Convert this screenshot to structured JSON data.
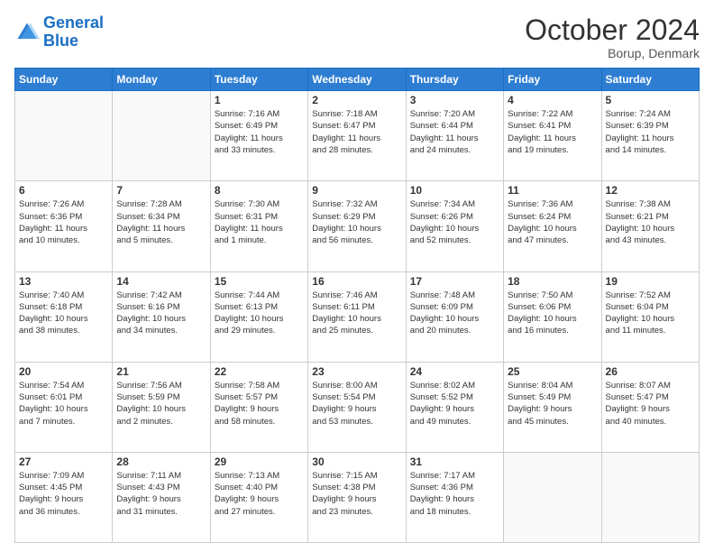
{
  "header": {
    "logo_line1": "General",
    "logo_line2": "Blue",
    "month": "October 2024",
    "location": "Borup, Denmark"
  },
  "days_of_week": [
    "Sunday",
    "Monday",
    "Tuesday",
    "Wednesday",
    "Thursday",
    "Friday",
    "Saturday"
  ],
  "weeks": [
    [
      {
        "day": "",
        "info": ""
      },
      {
        "day": "",
        "info": ""
      },
      {
        "day": "1",
        "info": "Sunrise: 7:16 AM\nSunset: 6:49 PM\nDaylight: 11 hours\nand 33 minutes."
      },
      {
        "day": "2",
        "info": "Sunrise: 7:18 AM\nSunset: 6:47 PM\nDaylight: 11 hours\nand 28 minutes."
      },
      {
        "day": "3",
        "info": "Sunrise: 7:20 AM\nSunset: 6:44 PM\nDaylight: 11 hours\nand 24 minutes."
      },
      {
        "day": "4",
        "info": "Sunrise: 7:22 AM\nSunset: 6:41 PM\nDaylight: 11 hours\nand 19 minutes."
      },
      {
        "day": "5",
        "info": "Sunrise: 7:24 AM\nSunset: 6:39 PM\nDaylight: 11 hours\nand 14 minutes."
      }
    ],
    [
      {
        "day": "6",
        "info": "Sunrise: 7:26 AM\nSunset: 6:36 PM\nDaylight: 11 hours\nand 10 minutes."
      },
      {
        "day": "7",
        "info": "Sunrise: 7:28 AM\nSunset: 6:34 PM\nDaylight: 11 hours\nand 5 minutes."
      },
      {
        "day": "8",
        "info": "Sunrise: 7:30 AM\nSunset: 6:31 PM\nDaylight: 11 hours\nand 1 minute."
      },
      {
        "day": "9",
        "info": "Sunrise: 7:32 AM\nSunset: 6:29 PM\nDaylight: 10 hours\nand 56 minutes."
      },
      {
        "day": "10",
        "info": "Sunrise: 7:34 AM\nSunset: 6:26 PM\nDaylight: 10 hours\nand 52 minutes."
      },
      {
        "day": "11",
        "info": "Sunrise: 7:36 AM\nSunset: 6:24 PM\nDaylight: 10 hours\nand 47 minutes."
      },
      {
        "day": "12",
        "info": "Sunrise: 7:38 AM\nSunset: 6:21 PM\nDaylight: 10 hours\nand 43 minutes."
      }
    ],
    [
      {
        "day": "13",
        "info": "Sunrise: 7:40 AM\nSunset: 6:18 PM\nDaylight: 10 hours\nand 38 minutes."
      },
      {
        "day": "14",
        "info": "Sunrise: 7:42 AM\nSunset: 6:16 PM\nDaylight: 10 hours\nand 34 minutes."
      },
      {
        "day": "15",
        "info": "Sunrise: 7:44 AM\nSunset: 6:13 PM\nDaylight: 10 hours\nand 29 minutes."
      },
      {
        "day": "16",
        "info": "Sunrise: 7:46 AM\nSunset: 6:11 PM\nDaylight: 10 hours\nand 25 minutes."
      },
      {
        "day": "17",
        "info": "Sunrise: 7:48 AM\nSunset: 6:09 PM\nDaylight: 10 hours\nand 20 minutes."
      },
      {
        "day": "18",
        "info": "Sunrise: 7:50 AM\nSunset: 6:06 PM\nDaylight: 10 hours\nand 16 minutes."
      },
      {
        "day": "19",
        "info": "Sunrise: 7:52 AM\nSunset: 6:04 PM\nDaylight: 10 hours\nand 11 minutes."
      }
    ],
    [
      {
        "day": "20",
        "info": "Sunrise: 7:54 AM\nSunset: 6:01 PM\nDaylight: 10 hours\nand 7 minutes."
      },
      {
        "day": "21",
        "info": "Sunrise: 7:56 AM\nSunset: 5:59 PM\nDaylight: 10 hours\nand 2 minutes."
      },
      {
        "day": "22",
        "info": "Sunrise: 7:58 AM\nSunset: 5:57 PM\nDaylight: 9 hours\nand 58 minutes."
      },
      {
        "day": "23",
        "info": "Sunrise: 8:00 AM\nSunset: 5:54 PM\nDaylight: 9 hours\nand 53 minutes."
      },
      {
        "day": "24",
        "info": "Sunrise: 8:02 AM\nSunset: 5:52 PM\nDaylight: 9 hours\nand 49 minutes."
      },
      {
        "day": "25",
        "info": "Sunrise: 8:04 AM\nSunset: 5:49 PM\nDaylight: 9 hours\nand 45 minutes."
      },
      {
        "day": "26",
        "info": "Sunrise: 8:07 AM\nSunset: 5:47 PM\nDaylight: 9 hours\nand 40 minutes."
      }
    ],
    [
      {
        "day": "27",
        "info": "Sunrise: 7:09 AM\nSunset: 4:45 PM\nDaylight: 9 hours\nand 36 minutes."
      },
      {
        "day": "28",
        "info": "Sunrise: 7:11 AM\nSunset: 4:43 PM\nDaylight: 9 hours\nand 31 minutes."
      },
      {
        "day": "29",
        "info": "Sunrise: 7:13 AM\nSunset: 4:40 PM\nDaylight: 9 hours\nand 27 minutes."
      },
      {
        "day": "30",
        "info": "Sunrise: 7:15 AM\nSunset: 4:38 PM\nDaylight: 9 hours\nand 23 minutes."
      },
      {
        "day": "31",
        "info": "Sunrise: 7:17 AM\nSunset: 4:36 PM\nDaylight: 9 hours\nand 18 minutes."
      },
      {
        "day": "",
        "info": ""
      },
      {
        "day": "",
        "info": ""
      }
    ]
  ]
}
